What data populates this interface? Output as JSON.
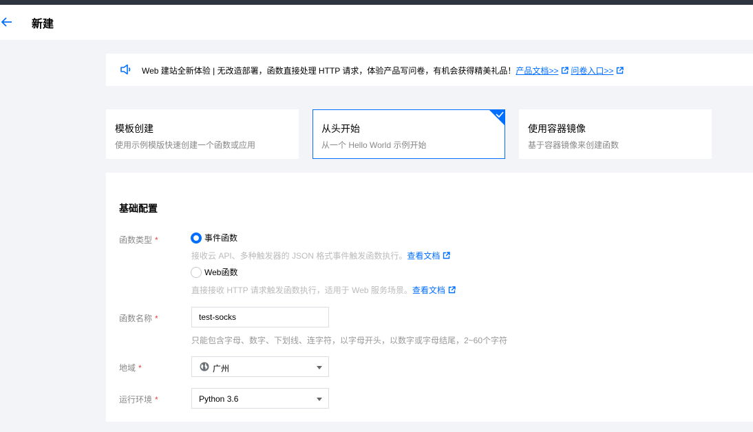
{
  "header": {
    "title": "新建"
  },
  "notice": {
    "text": "Web 建站全新体验 | 无改造部署，函数直接处理 HTTP 请求，体验产品写问卷，有机会获得精美礼品！",
    "link1": "产品文档>>",
    "link2": "问卷入口>>"
  },
  "cards": [
    {
      "title": "模板创建",
      "desc": "使用示例模版快速创建一个函数或应用",
      "selected": false
    },
    {
      "title": "从头开始",
      "desc": "从一个 Hello World 示例开始",
      "selected": true
    },
    {
      "title": "使用容器镜像",
      "desc": "基于容器镜像来创建函数",
      "selected": false
    }
  ],
  "form": {
    "section_title": "基础配置",
    "required_mark": "*",
    "function_type": {
      "label": "函数类型",
      "options": [
        {
          "label": "事件函数",
          "hint": "接收云 API、多种触发器的 JSON 格式事件触发函数执行。",
          "link": "查看文档",
          "checked": true
        },
        {
          "label": "Web函数",
          "hint": "直接接收 HTTP 请求触发函数执行，适用于 Web 服务场景。",
          "link": "查看文档",
          "checked": false
        }
      ]
    },
    "function_name": {
      "label": "函数名称",
      "value": "test-socks",
      "hint": "只能包含字母、数字、下划线、连字符，以字母开头，以数字或字母结尾，2~60个字符"
    },
    "region": {
      "label": "地域",
      "value": "广州"
    },
    "runtime": {
      "label": "运行环境",
      "value": "Python 3.6"
    }
  },
  "colors": {
    "accent": "#006eff",
    "topbar": "#2f3441",
    "required": "#e54545"
  },
  "icons": {
    "back": "arrow-left-icon",
    "notice": "speaker-icon",
    "external": "external-link-icon",
    "region": "globe-icon",
    "dropdown": "caret-down-icon",
    "selected": "check-icon"
  }
}
